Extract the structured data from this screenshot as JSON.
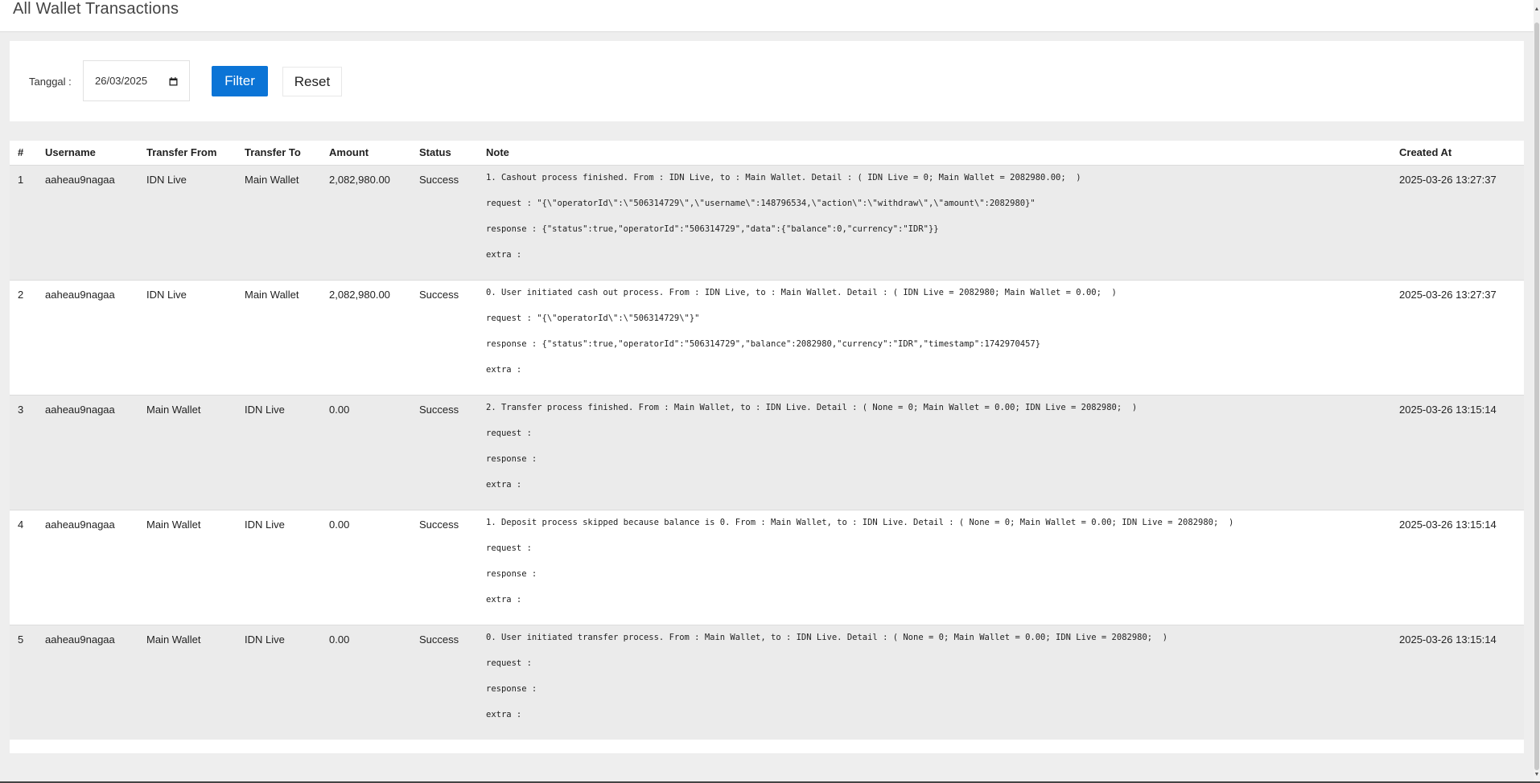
{
  "page": {
    "title": "All Wallet Transactions"
  },
  "filter": {
    "label": "Tanggal :",
    "date_value": "26/03/2025",
    "filter_label": "Filter",
    "reset_label": "Reset"
  },
  "table": {
    "headers": [
      "#",
      "Username",
      "Transfer From",
      "Transfer To",
      "Amount",
      "Status",
      "Note",
      "Created At"
    ],
    "rows": [
      {
        "num": "1",
        "username": "aaheau9nagaa",
        "from": "IDN Live",
        "to": "Main Wallet",
        "amount": "2,082,980.00",
        "status": "Success",
        "note": [
          "1. Cashout process finished. From : IDN Live, to : Main Wallet. Detail : ( IDN Live = 0; Main Wallet = 2082980.00;  )",
          "request : \"{\\\"operatorId\\\":\\\"506314729\\\",\\\"username\\\":148796534,\\\"action\\\":\\\"withdraw\\\",\\\"amount\\\":2082980}\"",
          "response : {\"status\":true,\"operatorId\":\"506314729\",\"data\":{\"balance\":0,\"currency\":\"IDR\"}}",
          "extra :"
        ],
        "created": "2025-03-26 13:27:37"
      },
      {
        "num": "2",
        "username": "aaheau9nagaa",
        "from": "IDN Live",
        "to": "Main Wallet",
        "amount": "2,082,980.00",
        "status": "Success",
        "note": [
          "0. User initiated cash out process. From : IDN Live, to : Main Wallet. Detail : ( IDN Live = 2082980; Main Wallet = 0.00;  )",
          "request : \"{\\\"operatorId\\\":\\\"506314729\\\"}\"",
          "response : {\"status\":true,\"operatorId\":\"506314729\",\"balance\":2082980,\"currency\":\"IDR\",\"timestamp\":1742970457}",
          "extra :"
        ],
        "created": "2025-03-26 13:27:37"
      },
      {
        "num": "3",
        "username": "aaheau9nagaa",
        "from": "Main Wallet",
        "to": "IDN Live",
        "amount": "0.00",
        "status": "Success",
        "note": [
          "2. Transfer process finished. From : Main Wallet, to : IDN Live. Detail : ( None = 0; Main Wallet = 0.00; IDN Live = 2082980;  )",
          "request :",
          "response :",
          "extra :"
        ],
        "created": "2025-03-26 13:15:14"
      },
      {
        "num": "4",
        "username": "aaheau9nagaa",
        "from": "Main Wallet",
        "to": "IDN Live",
        "amount": "0.00",
        "status": "Success",
        "note": [
          "1. Deposit process skipped because balance is 0. From : Main Wallet, to : IDN Live. Detail : ( None = 0; Main Wallet = 0.00; IDN Live = 2082980;  )",
          "request :",
          "response :",
          "extra :"
        ],
        "created": "2025-03-26 13:15:14"
      },
      {
        "num": "5",
        "username": "aaheau9nagaa",
        "from": "Main Wallet",
        "to": "IDN Live",
        "amount": "0.00",
        "status": "Success",
        "note": [
          "0. User initiated transfer process. From : Main Wallet, to : IDN Live. Detail : ( None = 0; Main Wallet = 0.00; IDN Live = 2082980;  )",
          "request :",
          "response :",
          "extra :"
        ],
        "created": "2025-03-26 13:15:14"
      }
    ]
  },
  "icons": {
    "date_picker": "calendar-icon"
  },
  "colors": {
    "primary_button": "#0b74d6",
    "row_shaded": "#ebebeb"
  }
}
